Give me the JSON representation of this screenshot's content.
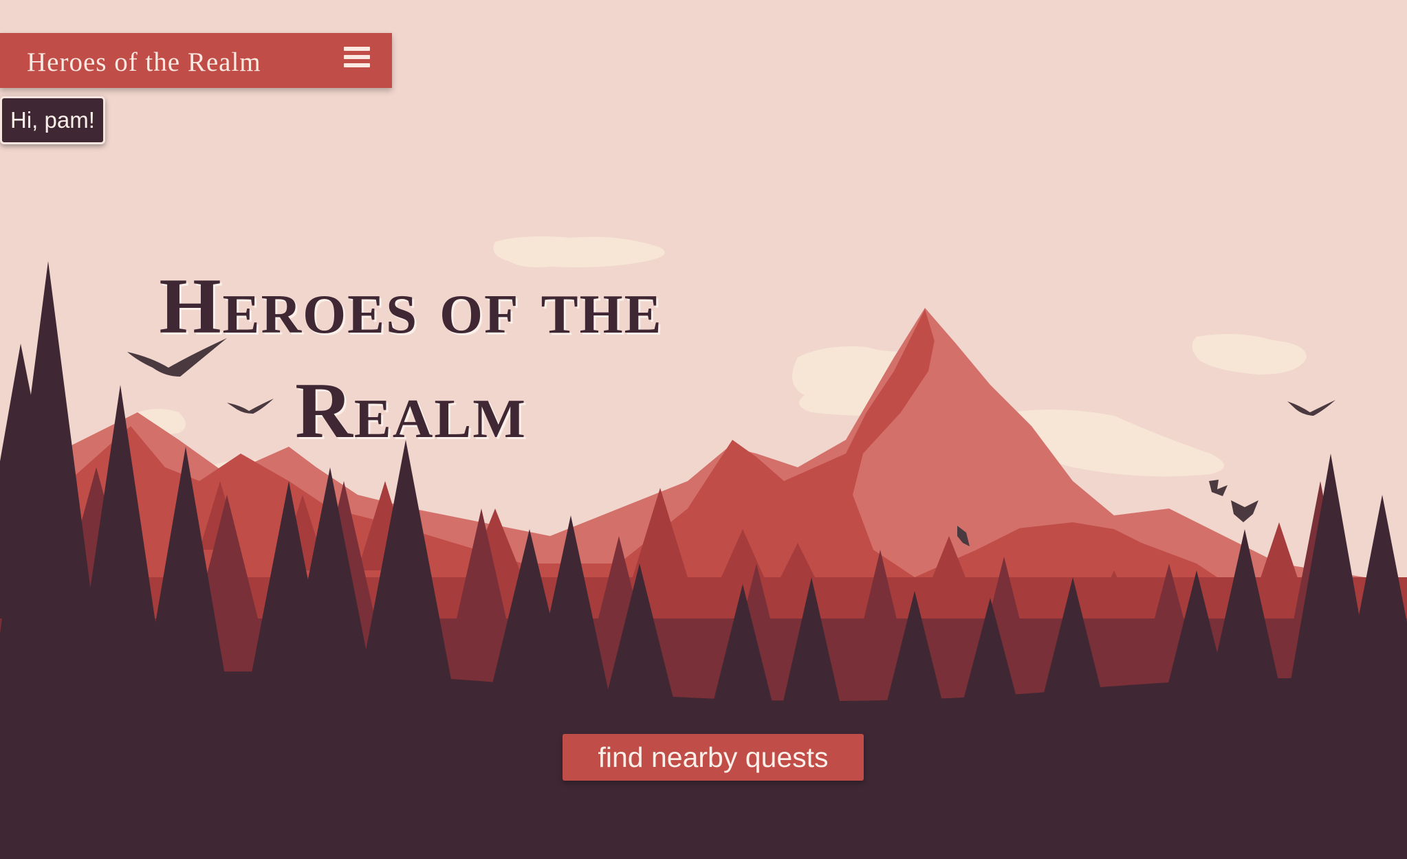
{
  "navbar": {
    "title": "Heroes of the Realm",
    "menu_icon": "hamburger-menu-icon"
  },
  "user": {
    "greeting": "Hi, pam!"
  },
  "hero": {
    "title": "Heroes of the Realm"
  },
  "cta": {
    "label": "find nearby quests"
  },
  "colors": {
    "sky": "#f1d6ce",
    "accent": "#c04d48",
    "dark": "#3f2834",
    "cream": "#fbefe9",
    "cloud": "#f7e6d6",
    "mountain_light": "#d4706a",
    "mountain_mid": "#c04d48",
    "forest_mid": "#7a3038",
    "forest_back": "#a63d3c"
  }
}
